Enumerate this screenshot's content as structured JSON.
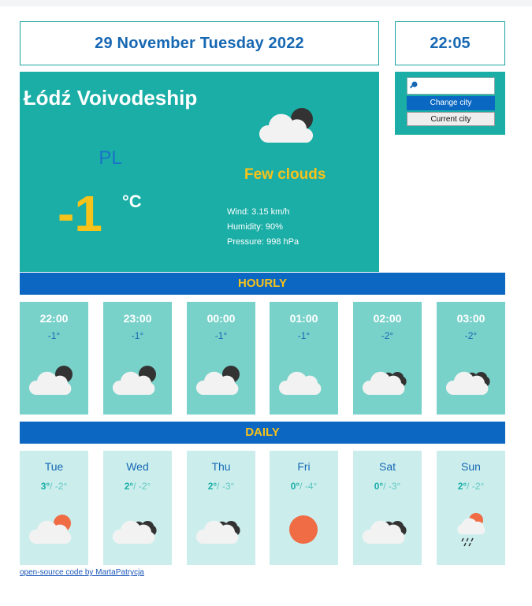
{
  "header": {
    "date": "29 November Tuesday 2022",
    "time": "22:05"
  },
  "current": {
    "city": "Łódź Voivodeship",
    "country": "PL",
    "temperature": "-1",
    "unit": "°C",
    "description": "Few clouds",
    "wind": "Wind: 3.15 km/h",
    "humidity": "Humidity: 90%",
    "pressure": "Pressure: 998 hPa",
    "icon": "cloud-night-icon"
  },
  "search": {
    "placeholder": "",
    "change_label": "Change city",
    "current_label": "Current city"
  },
  "sections": {
    "hourly": "HOURLY",
    "daily": "DAILY"
  },
  "hourly": [
    {
      "time": "22:00",
      "temp": "-1°",
      "icon": "cloud-night-icon"
    },
    {
      "time": "23:00",
      "temp": "-1°",
      "icon": "cloud-night-icon"
    },
    {
      "time": "00:00",
      "temp": "-1°",
      "icon": "cloud-night-icon"
    },
    {
      "time": "01:00",
      "temp": "-1°",
      "icon": "cloud-icon"
    },
    {
      "time": "02:00",
      "temp": "-2°",
      "icon": "broken-clouds-icon"
    },
    {
      "time": "03:00",
      "temp": "-2°",
      "icon": "broken-clouds-icon"
    }
  ],
  "daily": [
    {
      "day": "Tue",
      "max": "3°",
      "min": "-2°",
      "icon": "cloud-sun-icon"
    },
    {
      "day": "Wed",
      "max": "2°",
      "min": "-2°",
      "icon": "broken-clouds-icon"
    },
    {
      "day": "Thu",
      "max": "2°",
      "min": "-3°",
      "icon": "broken-clouds-icon"
    },
    {
      "day": "Fri",
      "max": "0°",
      "min": "-4°",
      "icon": "sun-icon"
    },
    {
      "day": "Sat",
      "max": "0°",
      "min": "-3°",
      "icon": "broken-clouds-icon"
    },
    {
      "day": "Sun",
      "max": "2°",
      "min": "-2°",
      "icon": "rain-sun-icon"
    }
  ],
  "footer": {
    "link": "open-source code by MartaPatrycja"
  },
  "colors": {
    "teal": "#1aaea6",
    "blue": "#0b67c2",
    "yellow": "#f7c21a",
    "light_teal": "#79d2ca",
    "pale_teal": "#cbeeed"
  }
}
